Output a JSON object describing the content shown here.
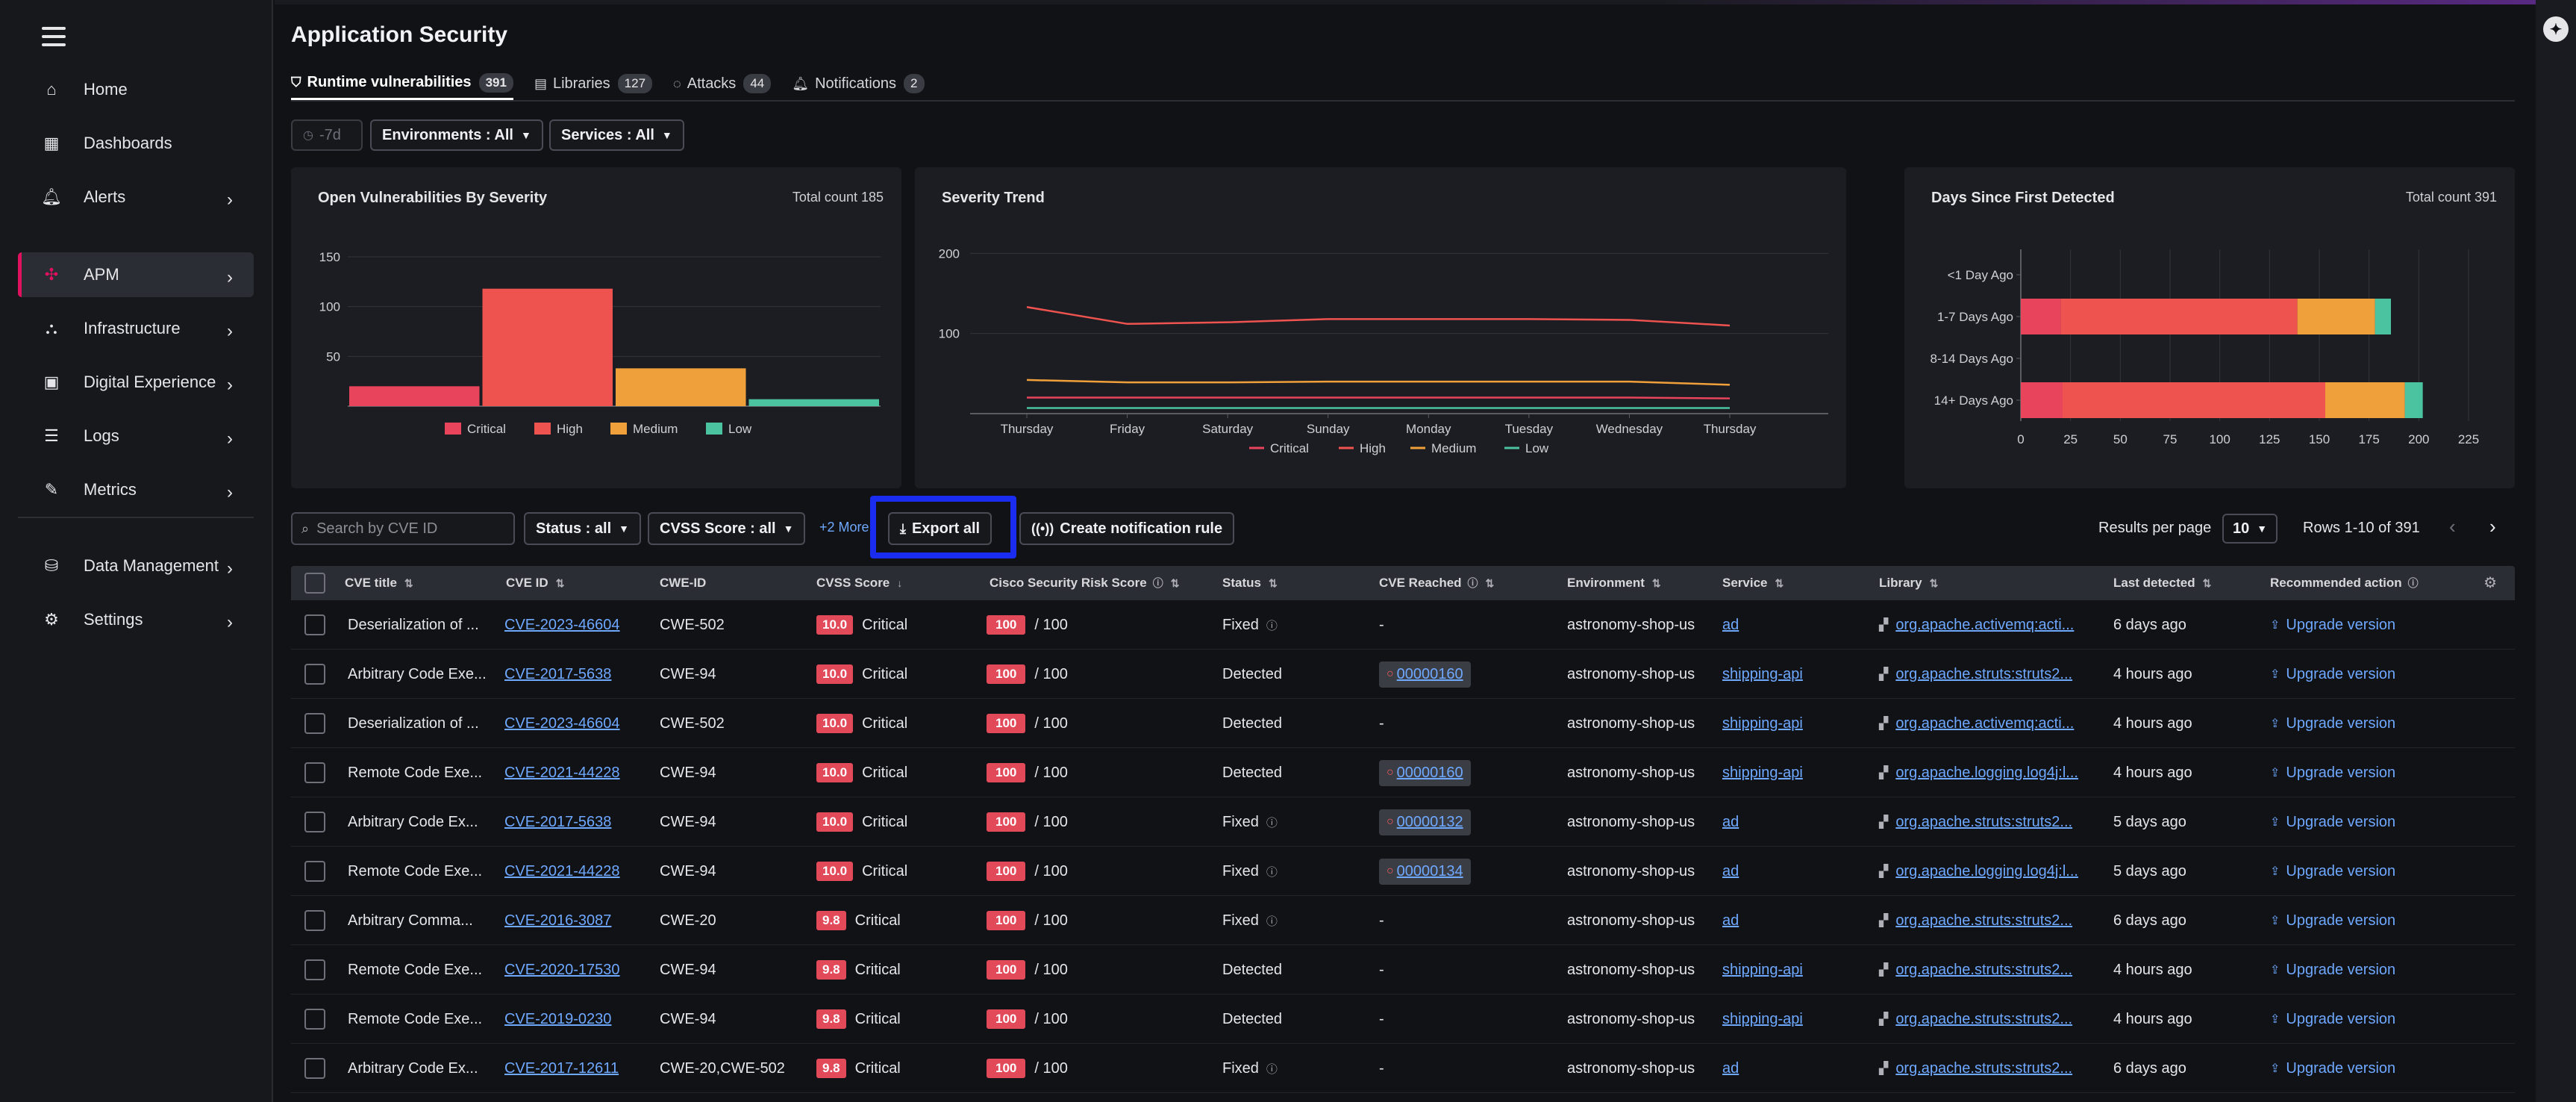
{
  "sidebar": {
    "items": [
      {
        "label": "Home",
        "icon": "home-icon",
        "chevron": false
      },
      {
        "label": "Dashboards",
        "icon": "dashboards-icon",
        "chevron": false
      },
      {
        "label": "Alerts",
        "icon": "bell-icon",
        "chevron": true
      },
      {
        "label": "APM",
        "icon": "apm-icon",
        "chevron": true,
        "active": true
      },
      {
        "label": "Infrastructure",
        "icon": "infrastructure-icon",
        "chevron": true
      },
      {
        "label": "Digital Experience",
        "icon": "digital-experience-icon",
        "chevron": true
      },
      {
        "label": "Logs",
        "icon": "logs-icon",
        "chevron": true
      },
      {
        "label": "Metrics",
        "icon": "metrics-icon",
        "chevron": true
      },
      {
        "label": "Data Management",
        "icon": "database-icon",
        "chevron": true
      },
      {
        "label": "Settings",
        "icon": "gear-icon",
        "chevron": true
      }
    ]
  },
  "header": {
    "title": "Application Security",
    "tabs": [
      {
        "label": "Runtime vulnerabilities",
        "count": "391",
        "active": true
      },
      {
        "label": "Libraries",
        "count": "127"
      },
      {
        "label": "Attacks",
        "count": "44"
      },
      {
        "label": "Notifications",
        "count": "2"
      }
    ]
  },
  "filters": {
    "time": "-7d",
    "environments": "Environments : All",
    "services": "Services : All"
  },
  "cards": {
    "open_vuln": {
      "title": "Open Vulnerabilities By Severity",
      "total": "Total count 185"
    },
    "trend": {
      "title": "Severity Trend"
    },
    "days": {
      "title": "Days Since First Detected",
      "total": "Total count 391"
    }
  },
  "chart_data": [
    {
      "type": "bar",
      "title": "Open Vulnerabilities By Severity",
      "categories": [
        "Critical",
        "High",
        "Medium",
        "Low"
      ],
      "values": [
        20,
        118,
        38,
        7
      ],
      "ylim": [
        0,
        165
      ],
      "yticks": [
        50,
        100,
        150
      ],
      "colors": [
        "#e8445c",
        "#ef5350",
        "#f0a03a",
        "#4cc3a0"
      ],
      "legend": "bottom"
    },
    {
      "type": "line",
      "title": "Severity Trend",
      "categories": [
        "Thursday",
        "Friday",
        "Saturday",
        "Sunday",
        "Monday",
        "Tuesday",
        "Wednesday",
        "Thursday"
      ],
      "ylim": [
        0,
        205
      ],
      "yticks": [
        100,
        200
      ],
      "series": [
        {
          "name": "Critical",
          "color": "#e8445c",
          "values": [
            20,
            20,
            20,
            20,
            20,
            20,
            20,
            19
          ]
        },
        {
          "name": "High",
          "color": "#ef5350",
          "values": [
            133,
            112,
            114,
            118,
            118,
            118,
            117,
            110
          ]
        },
        {
          "name": "Medium",
          "color": "#f0a03a",
          "values": [
            42,
            39,
            39,
            40,
            40,
            40,
            40,
            36
          ]
        },
        {
          "name": "Low",
          "color": "#4cc3a0",
          "values": [
            7,
            7,
            7,
            7,
            7,
            7,
            7,
            7
          ]
        }
      ],
      "legend": "bottom"
    },
    {
      "type": "bar",
      "orientation": "horizontal",
      "stacked": true,
      "title": "Days Since First Detected",
      "categories": [
        "<1 Day Ago",
        "1-7 Days Ago",
        "8-14 Days Ago",
        "14+ Days Ago"
      ],
      "xlim": [
        0,
        225
      ],
      "xticks": [
        0,
        25,
        50,
        75,
        100,
        125,
        150,
        175,
        200,
        225
      ],
      "series": [
        {
          "name": "Critical",
          "color": "#e8445c",
          "values": [
            0,
            20,
            0,
            21
          ]
        },
        {
          "name": "High",
          "color": "#ef5350",
          "values": [
            0,
            119,
            0,
            132
          ]
        },
        {
          "name": "Medium",
          "color": "#f0a03a",
          "values": [
            0,
            39,
            0,
            40
          ]
        },
        {
          "name": "Low",
          "color": "#4cc3a0",
          "values": [
            0,
            8,
            0,
            9
          ]
        }
      ]
    }
  ],
  "toolbar": {
    "search_placeholder": "Search by CVE ID",
    "status": "Status : all",
    "cvss": "CVSS Score : all",
    "more": "+2 More",
    "export": "Export all",
    "notify": "Create notification rule",
    "rpp_label": "Results per page",
    "rpp_value": "10",
    "rows_info": "Rows 1-10 of 391"
  },
  "table": {
    "headers": [
      "CVE title",
      "CVE ID",
      "CWE-ID",
      "CVSS Score",
      "Cisco Security Risk Score",
      "Status",
      "CVE Reached",
      "Environment",
      "Service",
      "Library",
      "Last detected",
      "Recommended action"
    ],
    "rows": [
      {
        "title": "Deserialization of ...",
        "cve": "CVE-2023-46604",
        "cwe": "CWE-502",
        "cvss": "10.0",
        "sev": "Critical",
        "risk": "100",
        "risk_of": "/ 100",
        "status": "Fixed",
        "fixed": true,
        "reached": "-",
        "env": "astronomy-shop-us",
        "service": "ad",
        "library": "org.apache.activemq:acti...",
        "last": "6 days ago",
        "action": "Upgrade version"
      },
      {
        "title": "Arbitrary Code Exe...",
        "cve": "CVE-2017-5638",
        "cwe": "CWE-94",
        "cvss": "10.0",
        "sev": "Critical",
        "risk": "100",
        "risk_of": "/ 100",
        "status": "Detected",
        "fixed": false,
        "reached": "00000160",
        "env": "astronomy-shop-us",
        "service": "shipping-api",
        "library": "org.apache.struts:struts2...",
        "last": "4 hours ago",
        "action": "Upgrade version"
      },
      {
        "title": "Deserialization of ...",
        "cve": "CVE-2023-46604",
        "cwe": "CWE-502",
        "cvss": "10.0",
        "sev": "Critical",
        "risk": "100",
        "risk_of": "/ 100",
        "status": "Detected",
        "fixed": false,
        "reached": "-",
        "env": "astronomy-shop-us",
        "service": "shipping-api",
        "library": "org.apache.activemq:acti...",
        "last": "4 hours ago",
        "action": "Upgrade version"
      },
      {
        "title": "Remote Code Exe...",
        "cve": "CVE-2021-44228",
        "cwe": "CWE-94",
        "cvss": "10.0",
        "sev": "Critical",
        "risk": "100",
        "risk_of": "/ 100",
        "status": "Detected",
        "fixed": false,
        "reached": "00000160",
        "env": "astronomy-shop-us",
        "service": "shipping-api",
        "library": "org.apache.logging.log4j:l...",
        "last": "4 hours ago",
        "action": "Upgrade version"
      },
      {
        "title": "Arbitrary Code Ex...",
        "cve": "CVE-2017-5638",
        "cwe": "CWE-94",
        "cvss": "10.0",
        "sev": "Critical",
        "risk": "100",
        "risk_of": "/ 100",
        "status": "Fixed",
        "fixed": true,
        "reached": "00000132",
        "env": "astronomy-shop-us",
        "service": "ad",
        "library": "org.apache.struts:struts2...",
        "last": "5 days ago",
        "action": "Upgrade version"
      },
      {
        "title": "Remote Code Exe...",
        "cve": "CVE-2021-44228",
        "cwe": "CWE-94",
        "cvss": "10.0",
        "sev": "Critical",
        "risk": "100",
        "risk_of": "/ 100",
        "status": "Fixed",
        "fixed": true,
        "reached": "00000134",
        "env": "astronomy-shop-us",
        "service": "ad",
        "library": "org.apache.logging.log4j:l...",
        "last": "5 days ago",
        "action": "Upgrade version"
      },
      {
        "title": "Arbitrary Comma...",
        "cve": "CVE-2016-3087",
        "cwe": "CWE-20",
        "cvss": "9.8",
        "sev": "Critical",
        "risk": "100",
        "risk_of": "/ 100",
        "status": "Fixed",
        "fixed": true,
        "reached": "-",
        "env": "astronomy-shop-us",
        "service": "ad",
        "library": "org.apache.struts:struts2...",
        "last": "6 days ago",
        "action": "Upgrade version"
      },
      {
        "title": "Remote Code Exe...",
        "cve": "CVE-2020-17530",
        "cwe": "CWE-94",
        "cvss": "9.8",
        "sev": "Critical",
        "risk": "100",
        "risk_of": "/ 100",
        "status": "Detected",
        "fixed": false,
        "reached": "-",
        "env": "astronomy-shop-us",
        "service": "shipping-api",
        "library": "org.apache.struts:struts2...",
        "last": "4 hours ago",
        "action": "Upgrade version"
      },
      {
        "title": "Remote Code Exe...",
        "cve": "CVE-2019-0230",
        "cwe": "CWE-94",
        "cvss": "9.8",
        "sev": "Critical",
        "risk": "100",
        "risk_of": "/ 100",
        "status": "Detected",
        "fixed": false,
        "reached": "-",
        "env": "astronomy-shop-us",
        "service": "shipping-api",
        "library": "org.apache.struts:struts2...",
        "last": "4 hours ago",
        "action": "Upgrade version"
      },
      {
        "title": "Arbitrary Code Ex...",
        "cve": "CVE-2017-12611",
        "cwe": "CWE-20,CWE-502",
        "cvss": "9.8",
        "sev": "Critical",
        "risk": "100",
        "risk_of": "/ 100",
        "status": "Fixed",
        "fixed": true,
        "reached": "-",
        "env": "astronomy-shop-us",
        "service": "ad",
        "library": "org.apache.struts:struts2...",
        "last": "6 days ago",
        "action": "Upgrade version"
      }
    ]
  }
}
